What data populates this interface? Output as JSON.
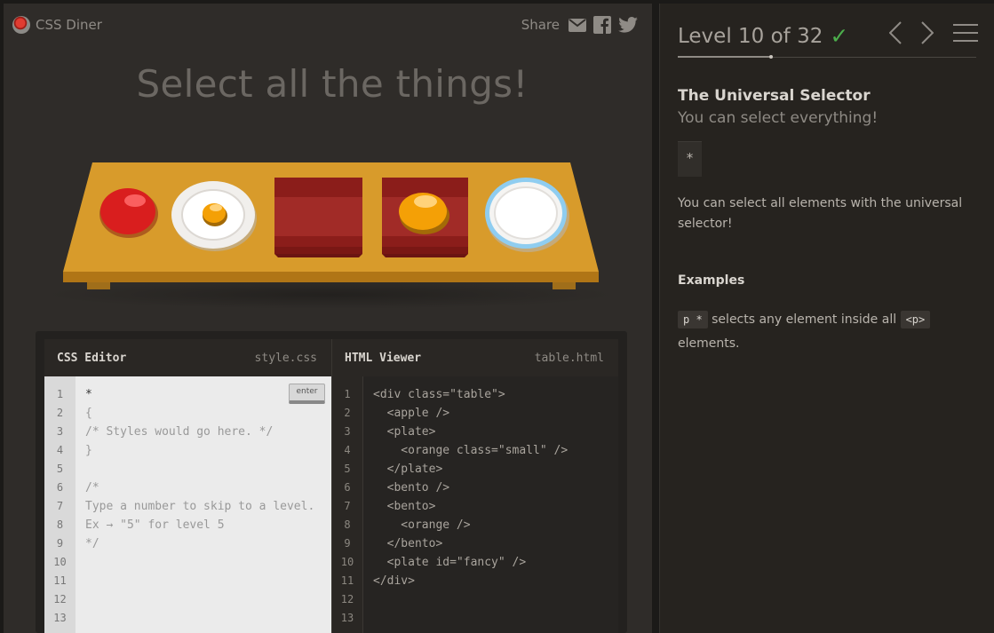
{
  "app": {
    "logo_text": "CSS Diner"
  },
  "share": {
    "label": "Share",
    "icons": [
      "email-icon",
      "facebook-icon",
      "twitter-icon"
    ]
  },
  "instruction": "Select all the things!",
  "table_items": [
    "apple",
    "plate-with-small-orange",
    "bento",
    "bento-with-orange",
    "fancy-plate"
  ],
  "editor": {
    "css": {
      "title": "CSS Editor",
      "filename": "style.css",
      "enter_label": "enter",
      "input_value": "*",
      "line_numbers": [
        "1",
        "2",
        "3",
        "4",
        "5",
        "6",
        "7",
        "8",
        "9",
        "10",
        "11",
        "12",
        "13"
      ],
      "lines": [
        "{",
        "/* Styles would go here. */",
        "}",
        "",
        "/*",
        "Type a number to skip to a level.",
        "Ex → \"5\" for level 5",
        "*/"
      ]
    },
    "html": {
      "title": "HTML Viewer",
      "filename": "table.html",
      "line_numbers": [
        "1",
        "2",
        "3",
        "4",
        "5",
        "6",
        "7",
        "8",
        "9",
        "10",
        "11",
        "12",
        "13"
      ],
      "lines": [
        "<div class=\"table\">",
        "  <apple />",
        "  <plate>",
        "    <orange class=\"small\" />",
        "  </plate>",
        "  <bento />",
        "  <bento>",
        "    <orange />",
        "  </bento>",
        "  <plate id=\"fancy\" />",
        "</div>"
      ]
    }
  },
  "level": {
    "title": "Level 10 of 32",
    "current": 10,
    "total": 32,
    "completed": true
  },
  "lesson": {
    "selector_name": "The Universal Selector",
    "title": "You can select everything!",
    "syntax": "*",
    "hint": "You can select all elements with the universal selector!",
    "examples_title": "Examples",
    "example": {
      "code1": "p *",
      "text1": "selects any element inside all",
      "code2": "<p>",
      "text2": "elements."
    }
  },
  "colors": {
    "accent_check": "#4cae4c",
    "table_top": "#d89b2b",
    "apple": "#d91e1e",
    "orange": "#f4a006",
    "bento": "#8b1d1a",
    "fancy_plate_rim": "#8fcdf0"
  }
}
